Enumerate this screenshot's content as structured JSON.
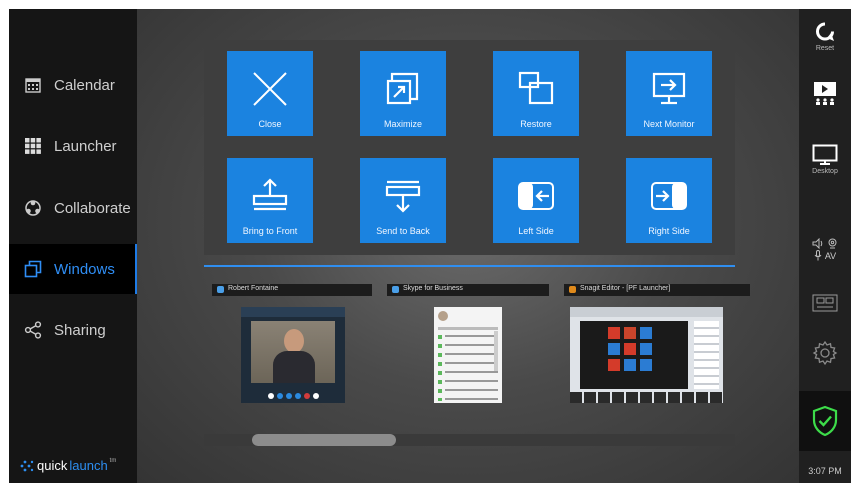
{
  "sidebar": {
    "items": [
      {
        "label": "Calendar",
        "icon": "calendar-icon"
      },
      {
        "label": "Launcher",
        "icon": "grid-icon"
      },
      {
        "label": "Collaborate",
        "icon": "collaborate-icon"
      },
      {
        "label": "Windows",
        "icon": "windows-icon",
        "active": true
      },
      {
        "label": "Sharing",
        "icon": "share-icon"
      }
    ],
    "brand_part1": "quick",
    "brand_part2": "launch",
    "brand_tm": "tm"
  },
  "actions": [
    {
      "label": "Close",
      "icon": "close-x-icon"
    },
    {
      "label": "Maximize",
      "icon": "maximize-icon"
    },
    {
      "label": "Restore",
      "icon": "restore-icon"
    },
    {
      "label": "Next Monitor",
      "icon": "next-monitor-icon"
    },
    {
      "label": "Bring to Front",
      "icon": "bring-to-front-icon"
    },
    {
      "label": "Send to Back",
      "icon": "send-to-back-icon"
    },
    {
      "label": "Left Side",
      "icon": "left-side-icon"
    },
    {
      "label": "Right Side",
      "icon": "right-side-icon"
    }
  ],
  "windows": [
    {
      "title": "Robert Fontaine",
      "app": "skype"
    },
    {
      "title": "Skype for Business",
      "app": "skype"
    },
    {
      "title": "Snagit Editor - [PF Launcher]",
      "app": "snagit"
    }
  ],
  "rightbar": {
    "reset_label": "Reset",
    "desktop_label": "Desktop",
    "av_label": "AV",
    "clock": "3:07 PM"
  },
  "colors": {
    "accent": "#1b83e0",
    "active_text": "#2f8ef5",
    "shield": "#3ddc4a"
  }
}
